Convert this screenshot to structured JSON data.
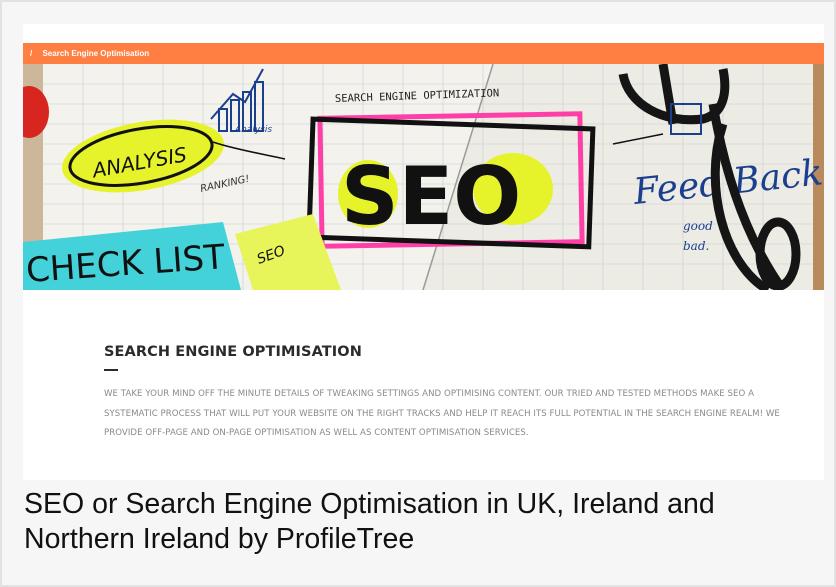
{
  "breadcrumb": {
    "separator": "/",
    "current": "Search Engine Optimisation"
  },
  "hero": {
    "alt_words": {
      "analysis": "ANALYSIS",
      "analysis_small": "Analysis",
      "ranking": "RANKING!",
      "header_note": "SEARCH ENGINE OPTIMIZATION",
      "seo_big": "SEO",
      "checklist": "CHECK LIST",
      "sticky_seo": "SEO",
      "feedback": "Feed Back",
      "good": "good",
      "bad": "bad."
    }
  },
  "section": {
    "title": "SEARCH ENGINE OPTIMISATION",
    "description": "WE TAKE YOUR MIND OFF THE MINUTE DETAILS OF TWEAKING SETTINGS AND OPTIMISING CONTENT. OUR TRIED AND TESTED METHODS MAKE SEO A SYSTEMATIC PROCESS THAT WILL PUT YOUR WEBSITE ON THE RIGHT TRACKS AND HELP IT REACH ITS FULL POTENTIAL IN THE SEARCH ENGINE REALM! WE PROVIDE OFF-PAGE AND ON-PAGE OPTIMISATION AS WELL AS CONTENT OPTIMISATION SERVICES."
  },
  "caption": "SEO or Search Engine Optimisation in UK, Ireland and Northern Ireland by ProfileTree",
  "colors": {
    "breadcrumb_bar": "#ff7f43",
    "title": "#2b2b2b",
    "description": "#8a8a8a",
    "highlight_yellow": "#e6f32a",
    "highlight_pink": "#ff3fa8",
    "ink_blue": "#1b3f8f"
  }
}
